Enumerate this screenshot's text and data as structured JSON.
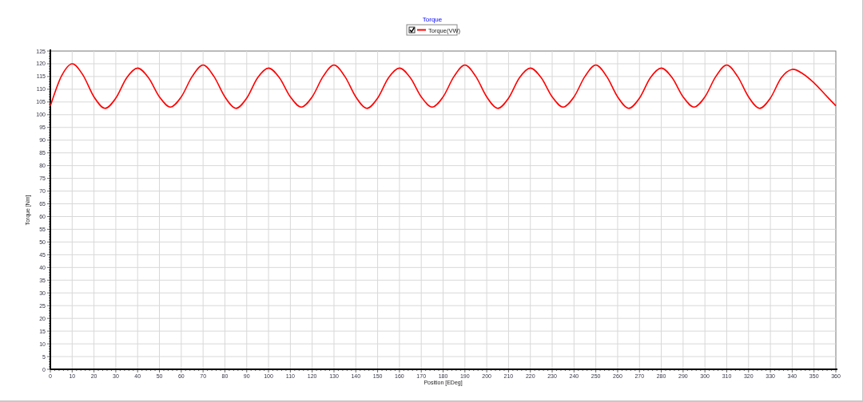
{
  "chart": {
    "legend": [
      {
        "checked": true
      }
    ],
    "chart_data": {
      "type": "line",
      "grid": true,
      "title": "Torque",
      "xlabel": "Position [EDeg]",
      "ylabel": "Torque [Nm]",
      "x": [
        0,
        5,
        10,
        15,
        20,
        25,
        30,
        35,
        40,
        45,
        50,
        55,
        60,
        65,
        70,
        75,
        80,
        85,
        90,
        95,
        100,
        105,
        110,
        115,
        120,
        125,
        130,
        135,
        140,
        145,
        150,
        155,
        160,
        165,
        170,
        175,
        180,
        185,
        190,
        195,
        200,
        205,
        210,
        215,
        220,
        225,
        230,
        235,
        240,
        245,
        250,
        255,
        260,
        265,
        270,
        275,
        280,
        285,
        290,
        295,
        300,
        305,
        310,
        315,
        320,
        325,
        330,
        335,
        340,
        345,
        350,
        355,
        360
      ],
      "series": [
        {
          "name": "Torque(VW)",
          "color": "#ff0000",
          "values": [
            103.5,
            115,
            120,
            115.5,
            107,
            102.5,
            106.5,
            114.5,
            118.3,
            114.5,
            107,
            103,
            107,
            115,
            119.5,
            115,
            107,
            102.5,
            106.5,
            114.5,
            118.3,
            114.5,
            107,
            103,
            107,
            115,
            119.5,
            115,
            107,
            102.5,
            106.5,
            114.5,
            118.3,
            114.5,
            107,
            103,
            107,
            115,
            119.5,
            115,
            107,
            102.5,
            106.5,
            114.5,
            118.3,
            114.5,
            107,
            103,
            107,
            115,
            119.5,
            115,
            107,
            102.5,
            106.5,
            114.5,
            118.3,
            114.5,
            107,
            103,
            107,
            115,
            119.5,
            115,
            107,
            102.5,
            106.5,
            114.5,
            117.8,
            116,
            112.5,
            108,
            103.5
          ]
        }
      ],
      "xlim": [
        0,
        360
      ],
      "ylim": [
        0,
        125
      ],
      "xticks": [
        0,
        10,
        20,
        30,
        40,
        50,
        60,
        70,
        80,
        90,
        100,
        110,
        120,
        130,
        140,
        150,
        160,
        170,
        180,
        190,
        200,
        210,
        220,
        230,
        240,
        250,
        260,
        270,
        280,
        290,
        300,
        310,
        320,
        330,
        340,
        350,
        360
      ],
      "yticks": [
        0,
        5,
        10,
        15,
        20,
        25,
        30,
        35,
        40,
        45,
        50,
        55,
        60,
        65,
        70,
        75,
        80,
        85,
        90,
        95,
        100,
        105,
        110,
        115,
        120,
        125
      ]
    }
  }
}
